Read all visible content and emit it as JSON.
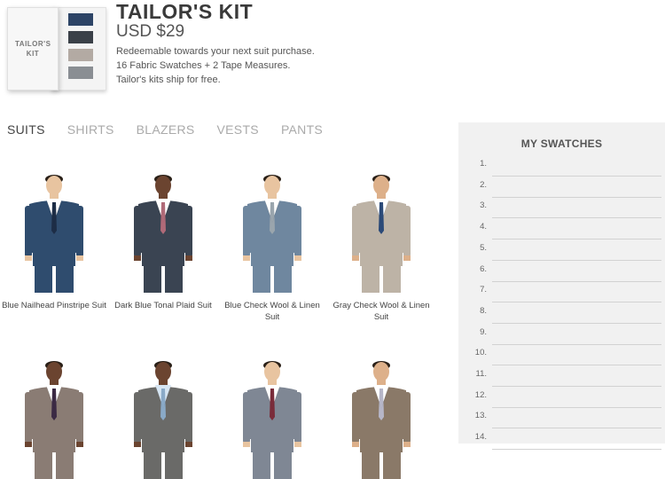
{
  "kit": {
    "box_label": "TAILOR'S KIT",
    "title": "TAILOR'S KIT",
    "price": "USD $29",
    "desc": [
      "Redeemable towards your next suit purchase.",
      "16 Fabric Swatches + 2 Tape Measures.",
      "Tailor's kits ship for free."
    ]
  },
  "tabs": [
    {
      "label": "SUITS",
      "active": true
    },
    {
      "label": "SHIRTS"
    },
    {
      "label": "BLAZERS"
    },
    {
      "label": "VESTS"
    },
    {
      "label": "PANTS"
    }
  ],
  "products": [
    {
      "name": "Blue Nailhead Pinstripe Suit",
      "suit": "#2f4c6e",
      "pants": "#2f4c6e",
      "tie": "#1d2d46",
      "shirt": "#ffffff",
      "skin": "#e8c4a0"
    },
    {
      "name": "Dark Blue Tonal Plaid Suit",
      "suit": "#3a4452",
      "pants": "#3a4452",
      "tie": "#b06a78",
      "shirt": "#ffffff",
      "skin": "#6b4430"
    },
    {
      "name": "Blue Check Wool & Linen Suit",
      "suit": "#6f879f",
      "pants": "#6f879f",
      "tie": "#9aa5ad",
      "shirt": "#ffffff",
      "skin": "#e8c4a0"
    },
    {
      "name": "Gray Check Wool & Linen Suit",
      "suit": "#bdb3a6",
      "pants": "#bdb3a6",
      "tie": "#2b4a78",
      "shirt": "#ffffff",
      "skin": "#ddb08a"
    },
    {
      "name": "",
      "suit": "#8a7c74",
      "pants": "#8a7c74",
      "tie": "#3b2a44",
      "shirt": "#ffffff",
      "skin": "#6b4430"
    },
    {
      "name": "",
      "suit": "#6a6a68",
      "pants": "#6a6a68",
      "tie": "#8aaac8",
      "shirt": "#d7e6f3",
      "skin": "#6b4430"
    },
    {
      "name": "",
      "suit": "#7f8794",
      "pants": "#7f8794",
      "tie": "#7a2c3a",
      "shirt": "#ffffff",
      "skin": "#e8c4a0"
    },
    {
      "name": "",
      "suit": "#8a7968",
      "pants": "#8a7968",
      "tie": "#b6b6c8",
      "shirt": "#ffffff",
      "skin": "#ddb08a"
    }
  ],
  "sidebar": {
    "title": "MY SWATCHES",
    "slots": [
      "1.",
      "2.",
      "3.",
      "4.",
      "5.",
      "6.",
      "7.",
      "8.",
      "9.",
      "10.",
      "11.",
      "12.",
      "13.",
      "14."
    ]
  }
}
